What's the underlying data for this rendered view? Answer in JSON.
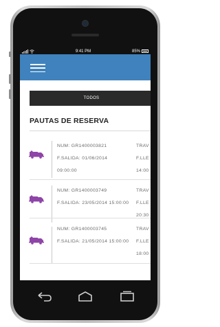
{
  "statusbar": {
    "time": "9:41 PM",
    "battery": "85%"
  },
  "tabs": [
    {
      "label": "TODOS"
    }
  ],
  "section": {
    "title": "PAUTAS DE RESERVA"
  },
  "reservations": [
    {
      "num": "NUM: GR1400003821",
      "salida": "F.SALIDA: 01/06/2014",
      "salida_time": "09:00:00",
      "col2_line1": "TRAV",
      "col2_line2": "F.LLE",
      "col2_line3": "14:00"
    },
    {
      "num": "NUM: GR1400003749",
      "salida": "F.SALIDA: 23/05/2014 15:00:00",
      "salida_time": "",
      "col2_line1": "TRAV",
      "col2_line2": "F.LLE",
      "col2_line3": "20:30"
    },
    {
      "num": "NUM: GR1400003745",
      "salida": "F.SALIDA: 21/05/2014 15:00:00",
      "salida_time": "",
      "col2_line1": "TRAV",
      "col2_line2": "F.LLE",
      "col2_line3": "18:00"
    }
  ],
  "icons": {
    "menu": "hamburger-icon",
    "row": "truck-icon",
    "back": "back-arrow-icon",
    "home": "home-icon",
    "recent": "recent-apps-icon"
  },
  "colors": {
    "appbar": "#3f82bd",
    "tabbar": "#2a2a2a",
    "row_icon": "#8e45a8"
  }
}
